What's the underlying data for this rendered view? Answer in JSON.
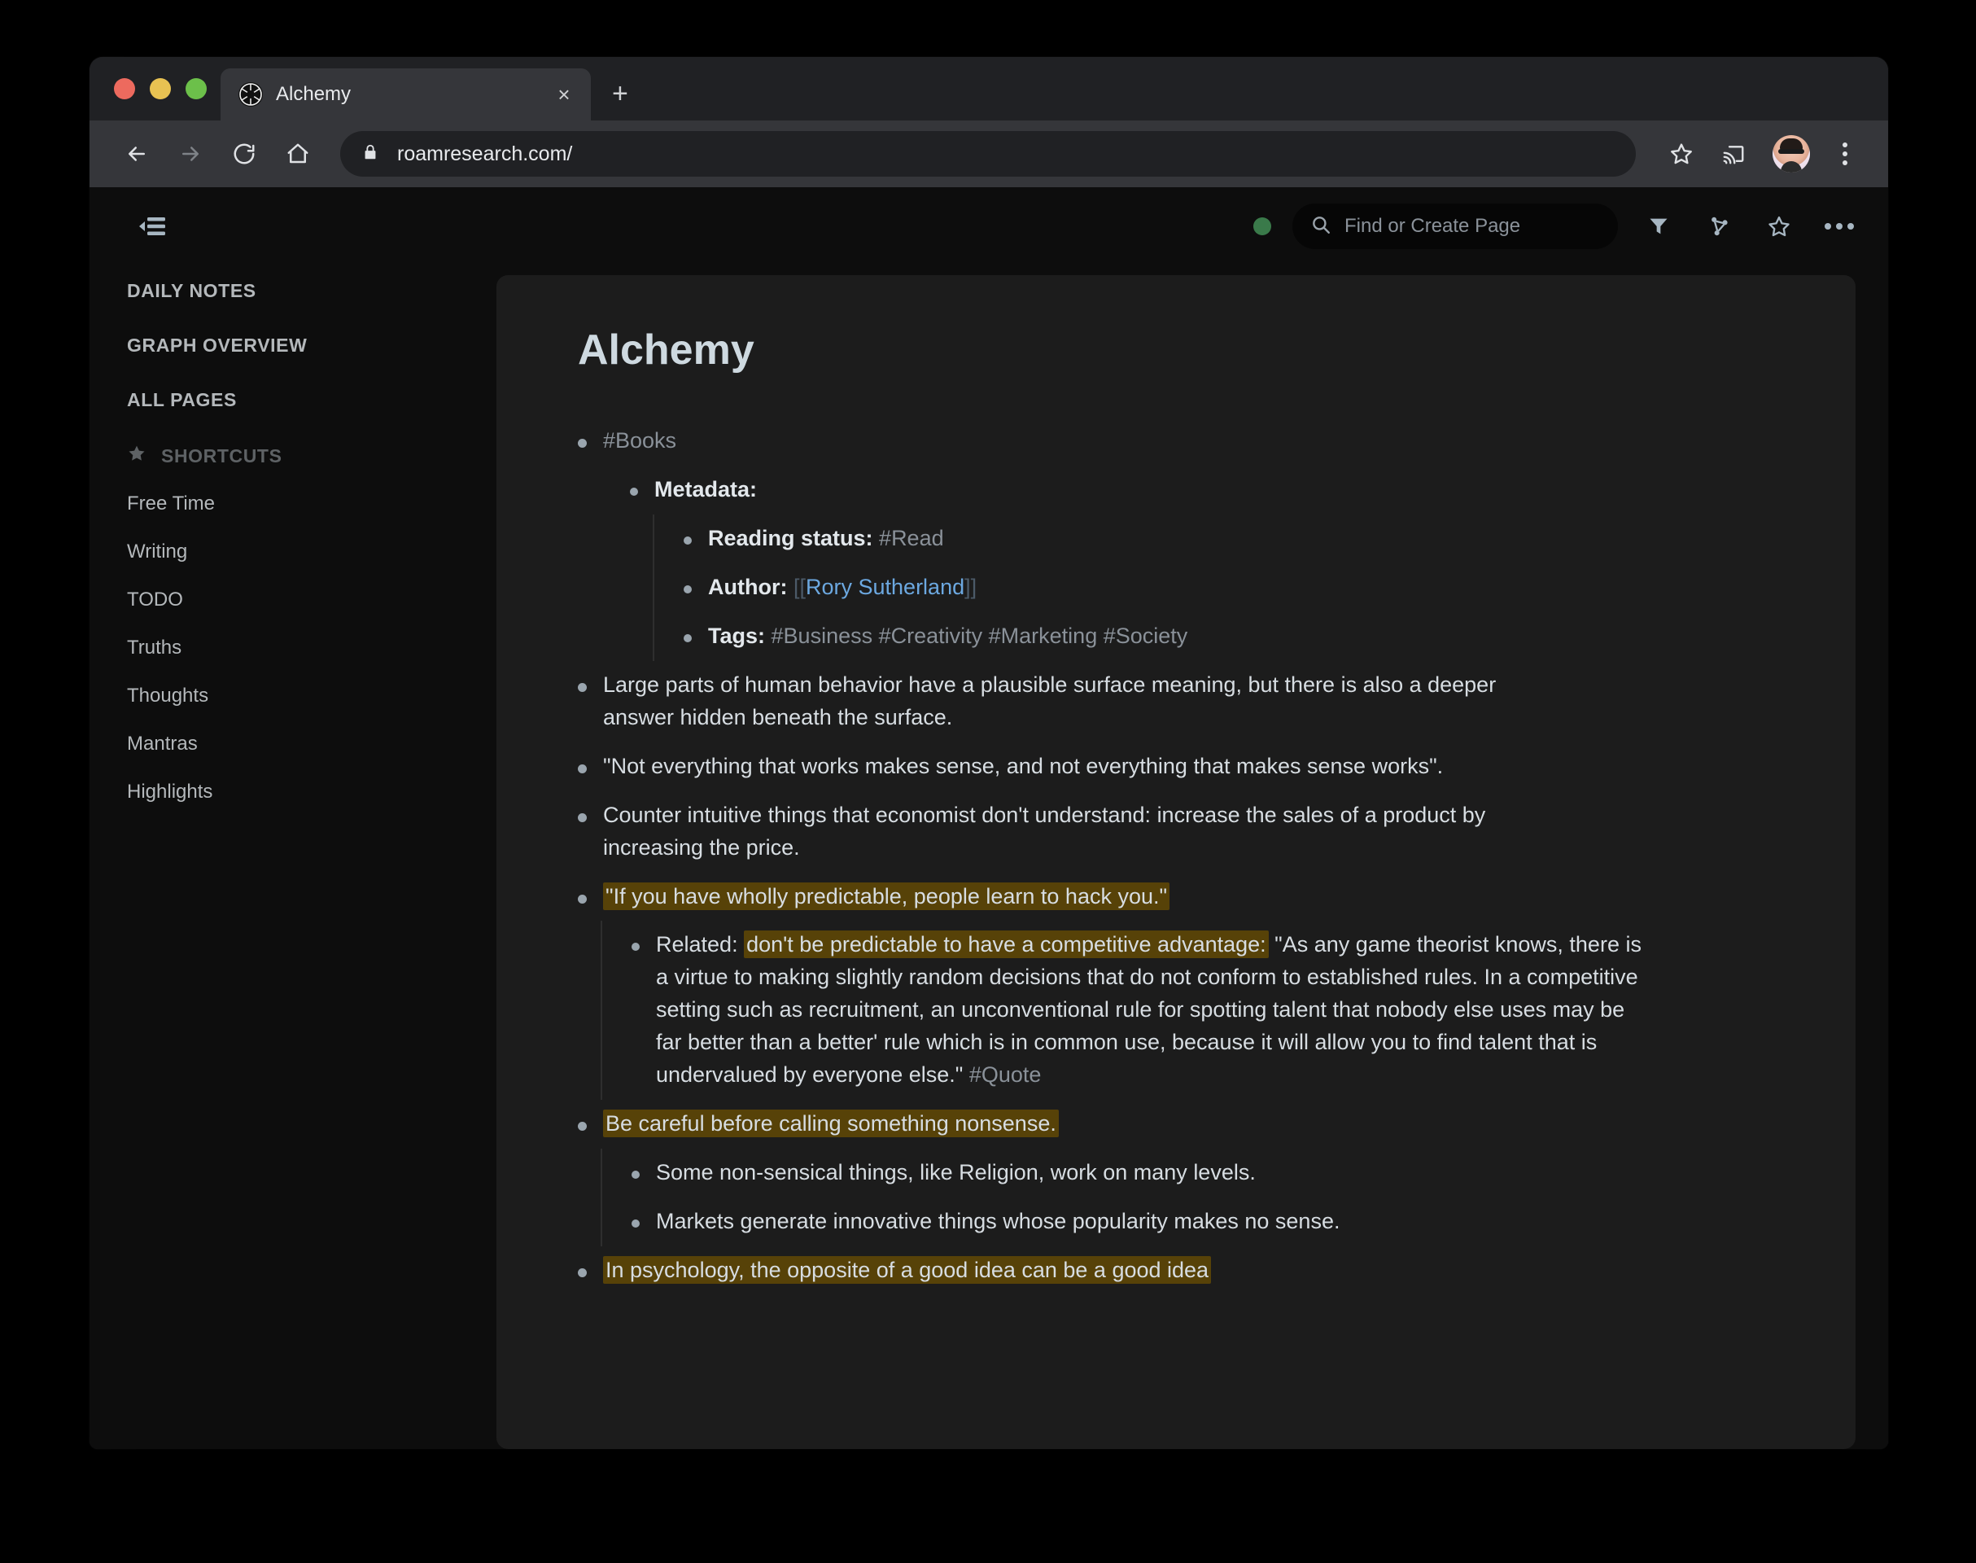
{
  "browser": {
    "tab": {
      "title": "Alchemy",
      "favicon_name": "roam-favicon",
      "close_label": "×"
    },
    "new_tab_label": "+",
    "url": "roamresearch.com/",
    "nav": {
      "back": "←",
      "forward": "→",
      "reload": "↻",
      "home": "⌂"
    },
    "icons": {
      "lock": "lock-icon",
      "bookmark": "star-icon",
      "cast": "cast-icon",
      "profile": "avatar",
      "menu": "kebab-menu-icon"
    }
  },
  "app": {
    "topbar": {
      "sidebar_toggle": "menu-closed-icon",
      "status": "online",
      "status_color": "#3a7a4a",
      "search_placeholder": "Find or Create Page",
      "search_value": "",
      "icons": [
        "filter-icon",
        "graph-icon",
        "star-icon",
        "more-icon"
      ]
    },
    "sidebar": {
      "primary": [
        {
          "label": "DAILY NOTES",
          "name": "sidebar-item-daily-notes"
        },
        {
          "label": "GRAPH OVERVIEW",
          "name": "sidebar-item-graph-overview"
        },
        {
          "label": "ALL PAGES",
          "name": "sidebar-item-all-pages"
        }
      ],
      "shortcuts_header": "SHORTCUTS",
      "shortcuts": [
        {
          "label": "Free Time"
        },
        {
          "label": "Writing"
        },
        {
          "label": "TODO"
        },
        {
          "label": "Truths"
        },
        {
          "label": "Thoughts"
        },
        {
          "label": "Mantras"
        },
        {
          "label": "Highlights"
        }
      ]
    },
    "page": {
      "title": "Alchemy",
      "books_tag": "#Books",
      "metadata_label": "Metadata:",
      "reading_status_label": "Reading status:",
      "reading_status_value": "#Read",
      "author_label": "Author:",
      "author_open": "[[",
      "author_name": "Rory Sutherland",
      "author_close": "]]",
      "tags_label": "Tags:",
      "tags_value": "#Business #Creativity #Marketing #Society",
      "block_1": "Large parts of human behavior have a plausible surface meaning, but there is also a deeper answer hidden beneath the surface.",
      "block_2": "\"Not everything that works makes sense, and not everything that makes sense works\".",
      "block_3": "Counter intuitive things that economist don't understand: increase the sales of a product by increasing the price.",
      "block_4_highlight": "\"If you have wholly predictable, people learn to hack you.\"",
      "related_prefix": "Related: ",
      "related_highlight": "don't be predictable to have a competitive advantage:",
      "related_rest": " \"As any game theorist knows, there is a virtue to making slightly random decisions that do not conform to established rules. In a competitive setting such as recruitment, an unconventional rule for spotting talent that nobody else uses may be far better than a better' rule which is in common use, because it will allow you to find talent that is undervalued by everyone else.\" ",
      "quote_tag": "#Quote",
      "block_5_highlight": "Be careful before calling something nonsense.",
      "block_5_child_1": "Some non-sensical things, like Religion, work on many levels.",
      "block_5_child_2": "Markets generate innovative things whose popularity makes no sense.",
      "block_6_highlight": "In psychology, the opposite of a good idea can be a good idea",
      "highlight_color": "#574208"
    }
  }
}
